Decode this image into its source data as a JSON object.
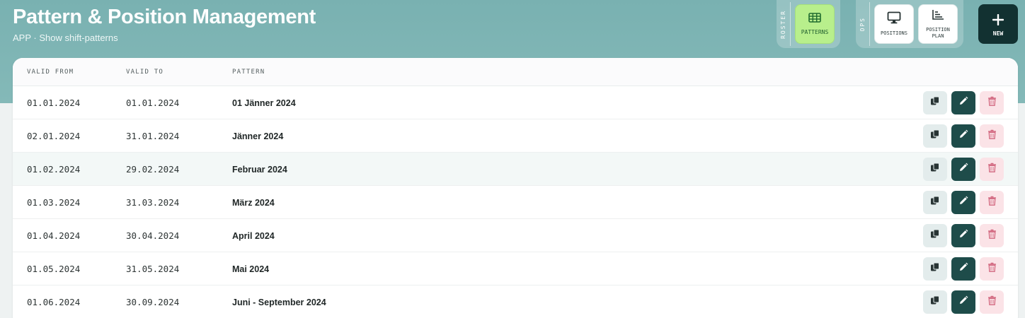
{
  "header": {
    "title": "Pattern & Position Management",
    "subtitle": "APP · Show shift-patterns"
  },
  "nav": {
    "roster_group": {
      "label": "ROSTER",
      "items": [
        {
          "label": "PATTERNS",
          "icon": "grid-icon",
          "active": true
        }
      ]
    },
    "ops_group": {
      "label": "OPS",
      "items": [
        {
          "label": "POSITIONS",
          "icon": "monitor-icon",
          "active": false
        },
        {
          "label": "POSITION PLAN",
          "icon": "chart-icon",
          "active": false
        }
      ]
    },
    "new_button": {
      "label": "NEW",
      "icon": "plus-icon"
    }
  },
  "table": {
    "columns": {
      "valid_from": "VALID FROM",
      "valid_to": "VALID TO",
      "pattern": "PATTERN"
    },
    "rows": [
      {
        "valid_from": "01.01.2024",
        "valid_to": "01.01.2024",
        "pattern": "01 Jänner 2024"
      },
      {
        "valid_from": "02.01.2024",
        "valid_to": "31.01.2024",
        "pattern": "Jänner 2024"
      },
      {
        "valid_from": "01.02.2024",
        "valid_to": "29.02.2024",
        "pattern": "Februar 2024"
      },
      {
        "valid_from": "01.03.2024",
        "valid_to": "31.03.2024",
        "pattern": "März 2024"
      },
      {
        "valid_from": "01.04.2024",
        "valid_to": "30.04.2024",
        "pattern": "April 2024"
      },
      {
        "valid_from": "01.05.2024",
        "valid_to": "31.05.2024",
        "pattern": "Mai 2024"
      },
      {
        "valid_from": "01.06.2024",
        "valid_to": "30.09.2024",
        "pattern": "Juni - September 2024"
      }
    ],
    "row_actions": [
      {
        "name": "copy",
        "icon": "copy-icon"
      },
      {
        "name": "edit",
        "icon": "pencil-icon"
      },
      {
        "name": "delete",
        "icon": "trash-icon"
      }
    ]
  },
  "colors": {
    "header_band": "#7fb5b5",
    "active_nav": "#b8ef8c",
    "new_button": "#123131",
    "edit_button": "#1e4c4a",
    "delete_button": "#fbe3e7",
    "delete_icon": "#d2677f",
    "copy_button": "#e3ecec"
  }
}
